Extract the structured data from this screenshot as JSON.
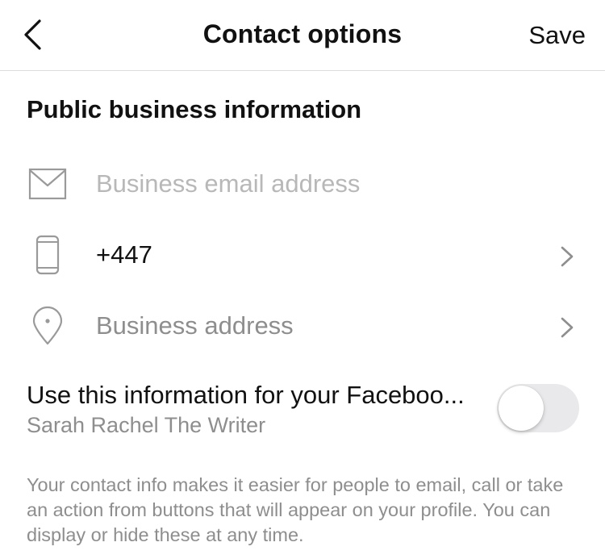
{
  "header": {
    "title": "Contact options",
    "save_label": "Save"
  },
  "section": {
    "title": "Public business information"
  },
  "fields": {
    "email": {
      "placeholder": "Business email address",
      "value": ""
    },
    "phone": {
      "value": "+447"
    },
    "address": {
      "placeholder": "Business address"
    }
  },
  "facebook": {
    "label": "Use this information for your Faceboo...",
    "page_name": "Sarah Rachel The Writer",
    "toggle_on": false
  },
  "footnote": "Your contact info makes it easier for people to email, call or take an action from buttons that will appear on your profile. You can display or hide these at any time.",
  "icons": {
    "back": "chevron-left-icon",
    "email": "envelope-icon",
    "phone": "phone-icon",
    "address": "location-pin-icon",
    "row_arrow": "chevron-right-icon"
  },
  "colors": {
    "text": "#111111",
    "muted": "#8e8e8e",
    "placeholder": "#b8b8b8",
    "toggle_off": "#e9e9eb"
  }
}
